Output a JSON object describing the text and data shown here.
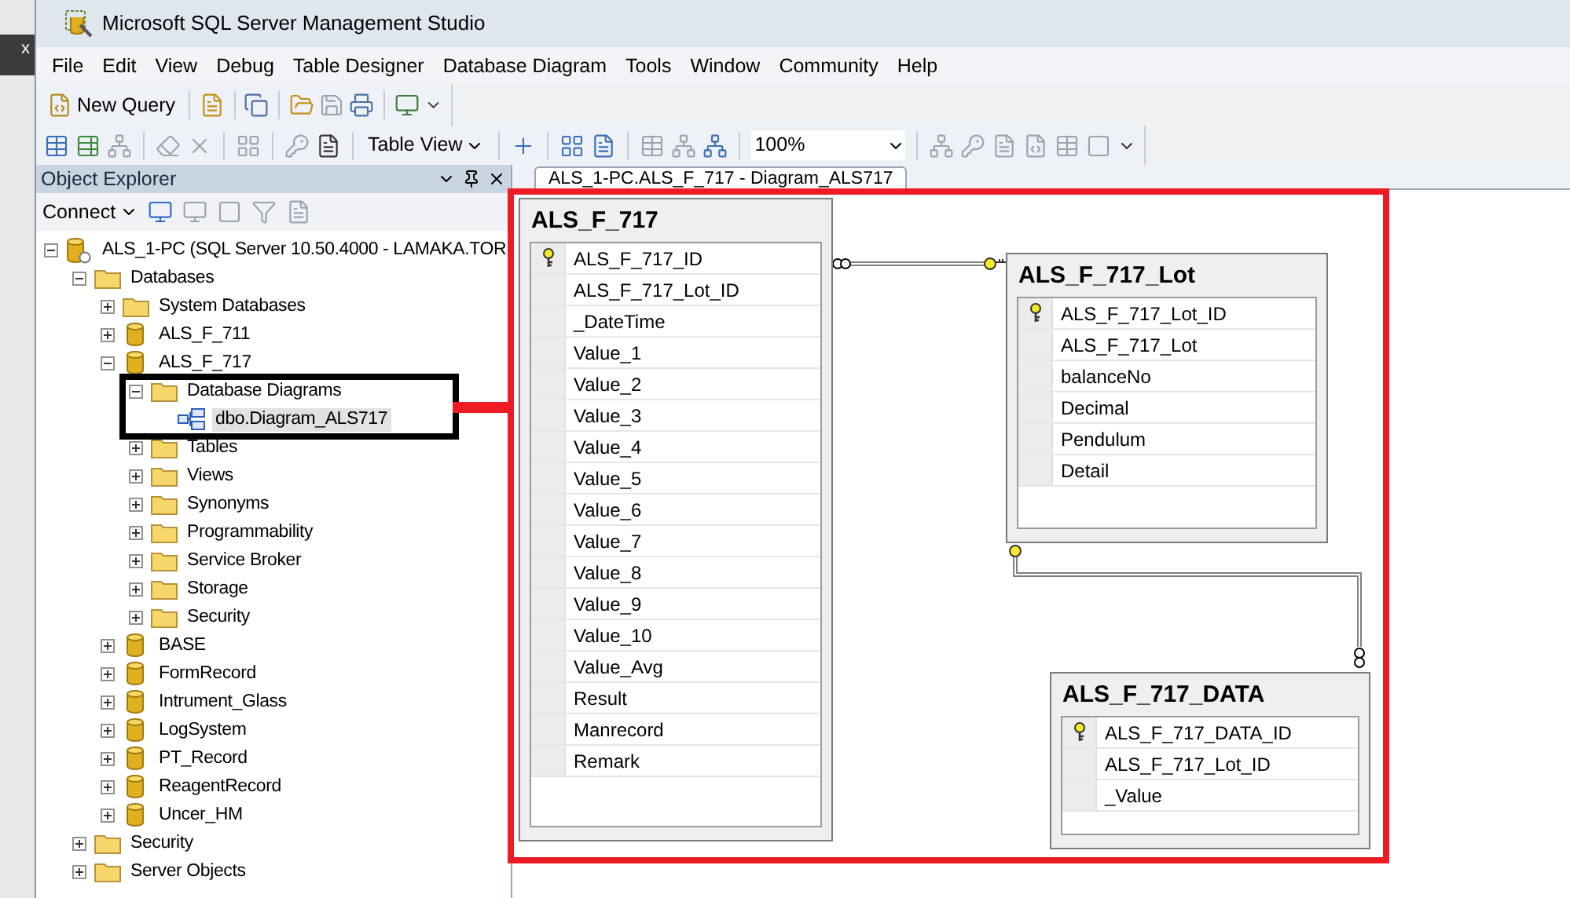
{
  "desktop": {
    "label": "x"
  },
  "window": {
    "title": "Microsoft SQL Server Management Studio"
  },
  "menu": [
    "File",
    "Edit",
    "View",
    "Debug",
    "Table Designer",
    "Database Diagram",
    "Tools",
    "Window",
    "Community",
    "Help"
  ],
  "toolbar": {
    "new_query": "New Query"
  },
  "diagram_toolbar": {
    "table_view": "Table View",
    "zoom": "100%"
  },
  "object_explorer": {
    "title": "Object Explorer",
    "connect": "Connect",
    "tree": [
      {
        "label": "ALS_1-PC (SQL Server 10.50.4000 - LAMAKA.TOR",
        "kind": "server",
        "expanded": true,
        "selected": false,
        "children": [
          {
            "label": "Databases",
            "kind": "folder",
            "expanded": true,
            "selected": false,
            "children": [
              {
                "label": "System Databases",
                "kind": "folder",
                "expanded": false,
                "selected": false
              },
              {
                "label": "ALS_F_711",
                "kind": "database",
                "expanded": false,
                "selected": false
              },
              {
                "label": "ALS_F_717",
                "kind": "database",
                "expanded": true,
                "selected": false,
                "children": [
                  {
                    "label": "Database Diagrams",
                    "kind": "folder",
                    "expanded": true,
                    "selected": false,
                    "children": [
                      {
                        "label": "dbo.Diagram_ALS717",
                        "kind": "diagram",
                        "selected": true
                      }
                    ]
                  },
                  {
                    "label": "Tables",
                    "kind": "folder",
                    "expanded": false,
                    "selected": false
                  },
                  {
                    "label": "Views",
                    "kind": "folder",
                    "expanded": false,
                    "selected": false
                  },
                  {
                    "label": "Synonyms",
                    "kind": "folder",
                    "expanded": false,
                    "selected": false
                  },
                  {
                    "label": "Programmability",
                    "kind": "folder",
                    "expanded": false,
                    "selected": false
                  },
                  {
                    "label": "Service Broker",
                    "kind": "folder",
                    "expanded": false,
                    "selected": false
                  },
                  {
                    "label": "Storage",
                    "kind": "folder",
                    "expanded": false,
                    "selected": false
                  },
                  {
                    "label": "Security",
                    "kind": "folder",
                    "expanded": false,
                    "selected": false
                  }
                ]
              },
              {
                "label": "BASE",
                "kind": "database",
                "expanded": false,
                "selected": false
              },
              {
                "label": "FormRecord",
                "kind": "database",
                "expanded": false,
                "selected": false
              },
              {
                "label": "Intrument_Glass",
                "kind": "database",
                "expanded": false,
                "selected": false
              },
              {
                "label": "LogSystem",
                "kind": "database",
                "expanded": false,
                "selected": false
              },
              {
                "label": "PT_Record",
                "kind": "database",
                "expanded": false,
                "selected": false
              },
              {
                "label": "ReagentRecord",
                "kind": "database",
                "expanded": false,
                "selected": false
              },
              {
                "label": "Uncer_HM",
                "kind": "database",
                "expanded": false,
                "selected": false
              }
            ]
          },
          {
            "label": "Security",
            "kind": "folder",
            "expanded": false,
            "selected": false
          },
          {
            "label": "Server Objects",
            "kind": "folder",
            "expanded": false,
            "selected": false
          }
        ]
      }
    ]
  },
  "document_tab": {
    "label": "ALS_1-PC.ALS_F_717 - Diagram_ALS717",
    "selected": true
  },
  "diagram": {
    "tables": [
      {
        "name": "ALS_F_717",
        "columns": [
          {
            "name": "ALS_F_717_ID",
            "primary_key": true
          },
          {
            "name": "ALS_F_717_Lot_ID",
            "primary_key": false
          },
          {
            "name": "_DateTime",
            "primary_key": false
          },
          {
            "name": "Value_1",
            "primary_key": false
          },
          {
            "name": "Value_2",
            "primary_key": false
          },
          {
            "name": "Value_3",
            "primary_key": false
          },
          {
            "name": "Value_4",
            "primary_key": false
          },
          {
            "name": "Value_5",
            "primary_key": false
          },
          {
            "name": "Value_6",
            "primary_key": false
          },
          {
            "name": "Value_7",
            "primary_key": false
          },
          {
            "name": "Value_8",
            "primary_key": false
          },
          {
            "name": "Value_9",
            "primary_key": false
          },
          {
            "name": "Value_10",
            "primary_key": false
          },
          {
            "name": "Value_Avg",
            "primary_key": false
          },
          {
            "name": "Result",
            "primary_key": false
          },
          {
            "name": "Manrecord",
            "primary_key": false
          },
          {
            "name": "Remark",
            "primary_key": false
          }
        ]
      },
      {
        "name": "ALS_F_717_Lot",
        "columns": [
          {
            "name": "ALS_F_717_Lot_ID",
            "primary_key": true
          },
          {
            "name": "ALS_F_717_Lot",
            "primary_key": false
          },
          {
            "name": "balanceNo",
            "primary_key": false
          },
          {
            "name": "Decimal",
            "primary_key": false
          },
          {
            "name": "Pendulum",
            "primary_key": false
          },
          {
            "name": "Detail",
            "primary_key": false
          }
        ]
      },
      {
        "name": "ALS_F_717_DATA",
        "columns": [
          {
            "name": "ALS_F_717_DATA_ID",
            "primary_key": true
          },
          {
            "name": "ALS_F_717_Lot_ID",
            "primary_key": false
          },
          {
            "name": "_Value",
            "primary_key": false
          }
        ]
      }
    ]
  }
}
